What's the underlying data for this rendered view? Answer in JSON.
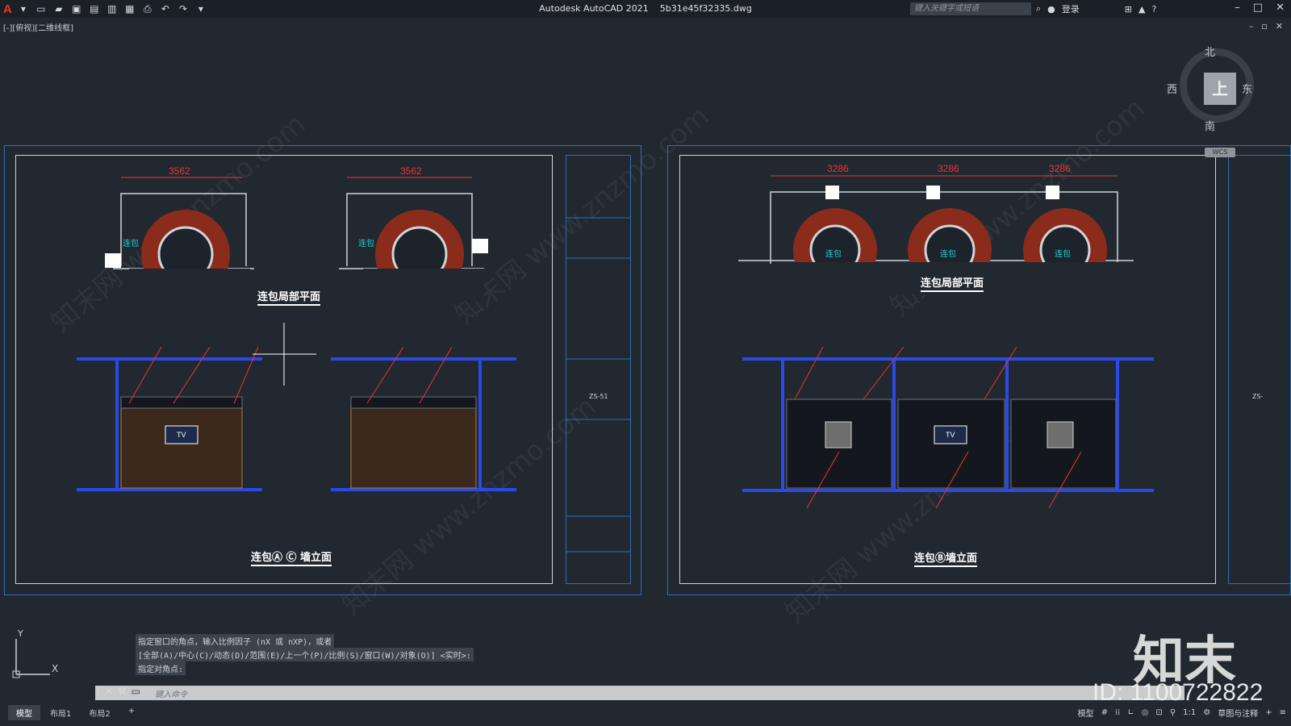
{
  "app": {
    "logo_letter": "A",
    "title": "Autodesk AutoCAD 2021",
    "filename": "5b31e45f32335.dwg",
    "search_placeholder": "键入关键字或短语",
    "login": "登录"
  },
  "viewport_label": "[-][俯视][二维线框]",
  "viewcube": {
    "north": "北",
    "south": "南",
    "west": "西",
    "east": "东",
    "face": "上",
    "wcs": "WCS"
  },
  "sheet_left": {
    "plan_title": "连包局部平面",
    "elev_title": "连包Ⓐ Ⓒ 墙立面",
    "dims": [
      "3562",
      "3562"
    ],
    "room_label": "连包",
    "tv": "TV",
    "code": "ZS-51"
  },
  "sheet_right": {
    "plan_title": "连包局部平面",
    "elev_title": "连包Ⓑ墙立面",
    "dims": [
      "3286",
      "3286",
      "3286"
    ],
    "room_label": "连包",
    "tv": "TV",
    "code": "ZS-"
  },
  "command": {
    "history": [
      "指定窗口的角点，输入比例因子 (nX 或 nXP)，或者",
      "[全部(A)/中心(C)/动态(D)/范围(E)/上一个(P)/比例(S)/窗口(W)/对象(O)] <实时>:",
      "指定对角点:"
    ],
    "placeholder": "键入命令"
  },
  "tabs": [
    "模型",
    "布局1",
    "布局2",
    "+"
  ],
  "status": {
    "model": "模型",
    "scale": "1:1",
    "workspace": "草图与注释"
  },
  "watermark": {
    "brand": "知末",
    "id": "ID: 1100722822",
    "diag": "知末网 www.znzmo.com"
  },
  "ucs": {
    "x": "X",
    "y": "Y"
  }
}
